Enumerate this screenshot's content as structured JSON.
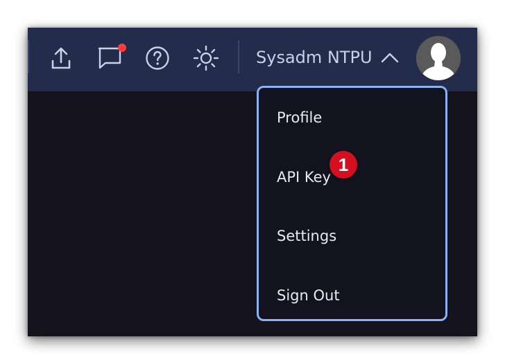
{
  "header": {
    "icons": {
      "upload": "upload-icon",
      "messages": "chat-bubble-icon",
      "help": "help-circle-icon",
      "theme": "sun-icon",
      "expand": "chevron-up-icon"
    },
    "has_notification": true,
    "user_name": "Sysadm NTPU"
  },
  "user_menu": {
    "items": [
      {
        "label": "Profile"
      },
      {
        "label": "API Key"
      },
      {
        "label": "Settings"
      },
      {
        "label": "Sign Out"
      }
    ]
  },
  "annotation": {
    "step": "1"
  },
  "colors": {
    "topbar": "#232c4a",
    "page_background": "#13121d",
    "menu_border": "#8ab4f8",
    "notification_dot": "#ff3b3b",
    "step_badge": "#d40f1f"
  }
}
